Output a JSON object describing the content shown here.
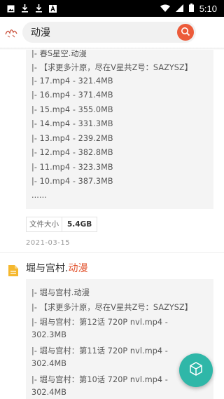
{
  "status_bar": {
    "time": "5:10",
    "left_icons": [
      "image-icon",
      "download-icon",
      "download-icon",
      "font-icon"
    ],
    "right_icons": [
      "wifi-icon",
      "signal-icon",
      "battery-icon"
    ]
  },
  "header": {
    "search_value": "动漫",
    "search_button_icon": "search-icon",
    "accent_color": "#ec5b3a"
  },
  "result1": {
    "lines": [
      "|- 春S星空.动漫",
      "|- 【求更多汁原，尽在V星共Z号：SAZYSZ】",
      "|- 17.mp4 - 321.4MB",
      "|- 16.mp4 - 371.4MB",
      "|- 15.mp4 - 355.0MB",
      "|- 14.mp4 - 331.3MB",
      "|- 13.mp4 - 239.2MB",
      "|- 12.mp4 - 382.8MB",
      "|- 11.mp4 - 323.3MB",
      "|- 10.mp4 - 387.3MB",
      "......"
    ],
    "size_label": "文件大小",
    "size_value": "5.4GB",
    "date": "2021-03-15"
  },
  "result2": {
    "title_prefix": "堀与宫村.",
    "title_keyword": "动漫",
    "keyword_color": "#e2532e",
    "icon": "file-icon",
    "lines": [
      "|- 堀与宫村.动漫",
      "|- 【求更多汁原，尽在V星共Z号：SAZYSZ】",
      "|- 堀与宫村：第12话 720P nvl.mp4 -",
      "302.3MB",
      "|- 堀与宫村：第11话 720P nvl.mp4 -",
      "302.4MB",
      "|- 堀与宫村：第10话 720P nvl.mp4 -",
      "302.4MB"
    ]
  },
  "fab": {
    "icon": "cube-icon",
    "color": "#2fb7a8"
  }
}
